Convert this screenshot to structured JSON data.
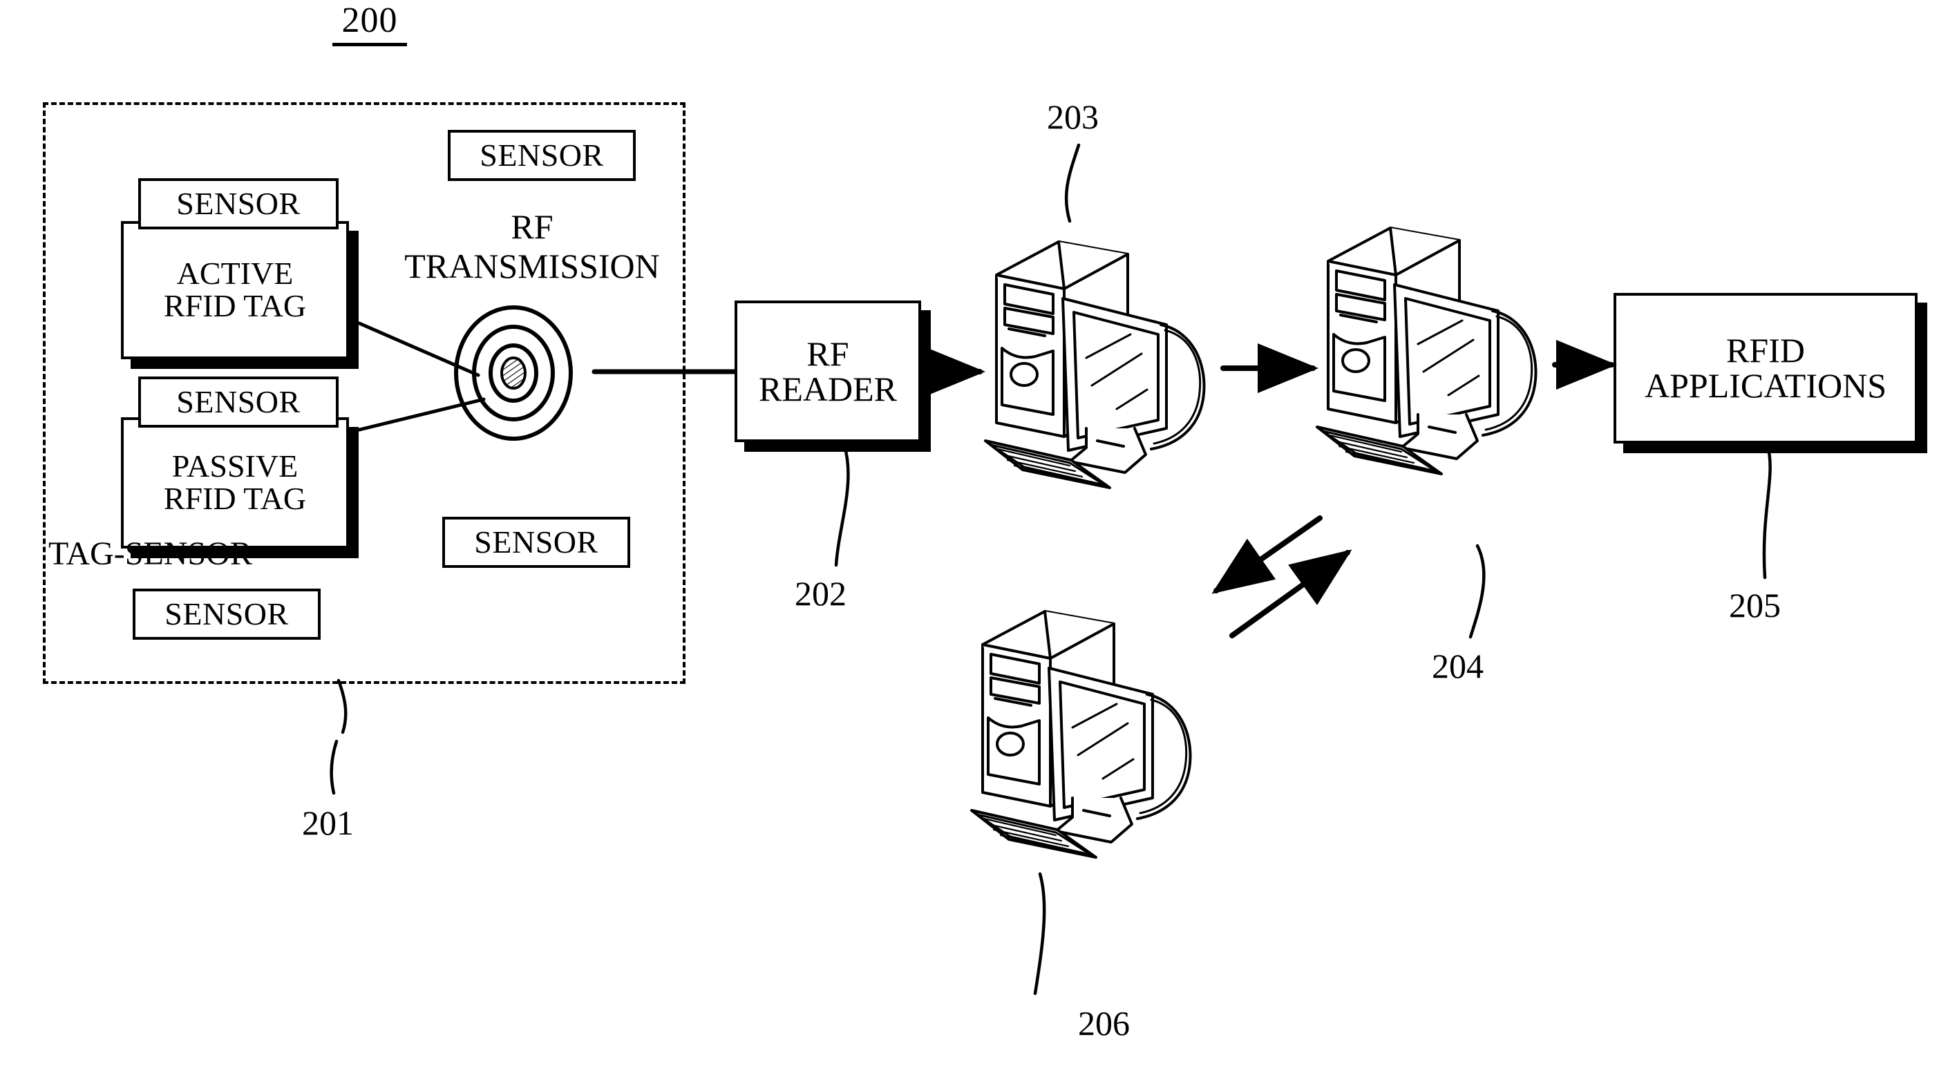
{
  "figure": {
    "number": "200",
    "kind": "patent-system-diagram",
    "title_text": "200"
  },
  "tag_sensor_region": {
    "caption": "TAG-SENSOR",
    "reference": "201",
    "border_style": "dashed",
    "active_tag": {
      "line1": "ACTIVE",
      "line2": "RFID TAG",
      "attached_sensor_label": "SENSOR"
    },
    "passive_tag": {
      "line1": "PASSIVE",
      "line2": "RFID TAG",
      "attached_sensor_label": "SENSOR"
    },
    "free_sensors": [
      {
        "label": "SENSOR",
        "position": "top-right"
      },
      {
        "label": "SENSOR",
        "position": "mid-right"
      },
      {
        "label": "SENSOR",
        "position": "bottom-left"
      }
    ],
    "rf_transmission": {
      "line1": "RF",
      "line2": "TRANSMISSION",
      "symbol": "concentric-rings-hatched-core"
    }
  },
  "rf_reader": {
    "line1": "RF",
    "line2": "READER",
    "reference": "202"
  },
  "computers": [
    {
      "name": "host-computer",
      "reference": "203"
    },
    {
      "name": "server-computer",
      "reference": "204"
    },
    {
      "name": "peer-computer",
      "reference": "206"
    }
  ],
  "rfid_applications": {
    "line1": "RFID",
    "line2": "APPLICATIONS",
    "reference": "205"
  },
  "connections": [
    {
      "from": "rf-symbol",
      "to": "rf-reader",
      "type": "line"
    },
    {
      "from": "rf-reader",
      "to": "computer-203",
      "type": "arrow-right"
    },
    {
      "from": "computer-203",
      "to": "computer-204",
      "type": "arrow-right"
    },
    {
      "from": "computer-204",
      "to": "rfid-applications",
      "type": "arrow-right"
    },
    {
      "from": "computer-204",
      "to": "computer-206",
      "type": "arrow-bidirectional-diagonal"
    },
    {
      "from": "active-rfid-tag",
      "to": "rf-symbol",
      "type": "leader-line"
    },
    {
      "from": "passive-rfid-tag",
      "to": "rf-symbol",
      "type": "leader-line"
    }
  ],
  "colors": {
    "ink": "#000000",
    "paper": "#ffffff"
  }
}
